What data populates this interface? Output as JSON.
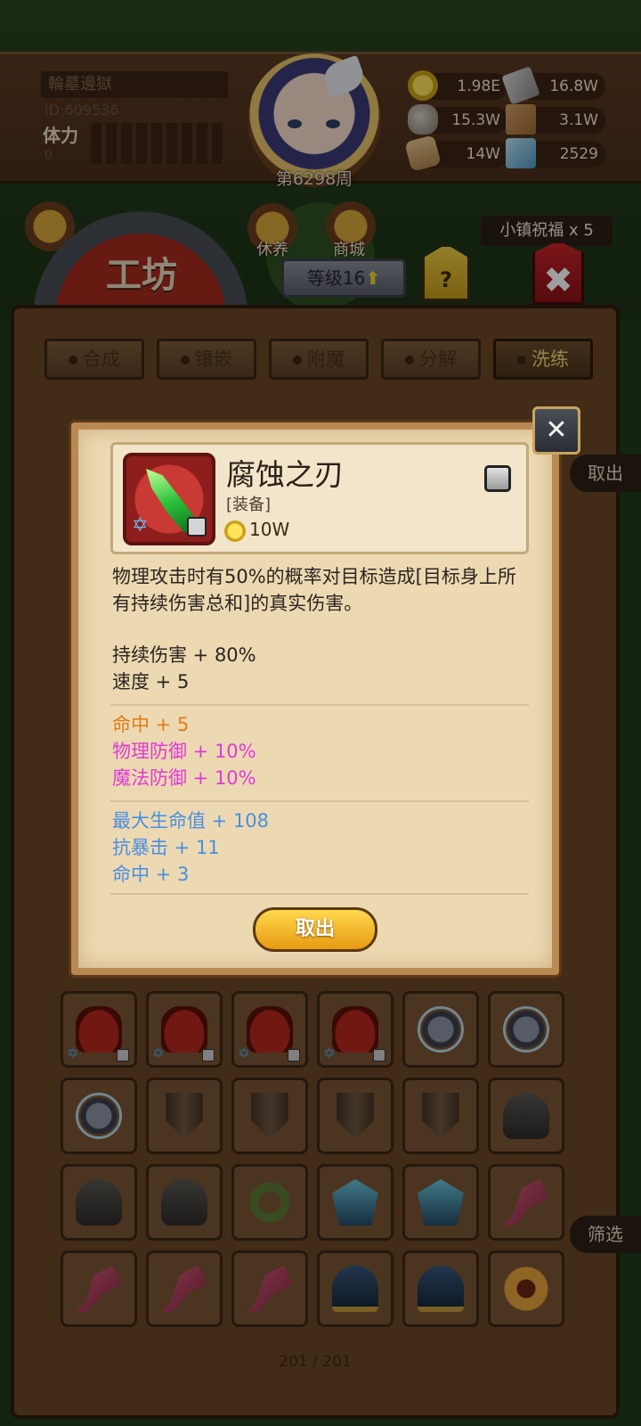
{
  "player": {
    "name": "輪墓邊獄",
    "id": "ID:609536",
    "stamina_label": "体力",
    "stamina_value": "0",
    "week": "第6298周"
  },
  "resources": {
    "gold": "1.98E",
    "ingot": "16.8W",
    "ore": "15.3W",
    "cloth": "3.1W",
    "wood": "14W",
    "gem": "2529"
  },
  "nav": {
    "rest": "休养",
    "shop": "商城",
    "blessing": "小镇祝福 x 5"
  },
  "workshop": {
    "title": "工坊",
    "level": "等级16",
    "help": "?",
    "close": "✖",
    "tabs": [
      {
        "label": "合成",
        "active": false
      },
      {
        "label": "镶嵌",
        "active": false
      },
      {
        "label": "附魔",
        "active": false
      },
      {
        "label": "分解",
        "active": false
      },
      {
        "label": "洗练",
        "active": true
      }
    ],
    "side_take": "取出",
    "side_filter": "筛选",
    "count": "201 / 201"
  },
  "inventory": [
    {
      "icon": "hat-icon",
      "star": true,
      "lock": true
    },
    {
      "icon": "hat-icon",
      "star": true,
      "lock": true
    },
    {
      "icon": "hat-icon",
      "star": true,
      "lock": true
    },
    {
      "icon": "hat-icon",
      "star": true,
      "lock": true
    },
    {
      "icon": "amulet-icon",
      "star": false,
      "lock": false
    },
    {
      "icon": "amulet-icon",
      "star": false,
      "lock": false
    },
    {
      "icon": "amulet-icon",
      "star": false,
      "lock": false
    },
    {
      "icon": "shield-icon",
      "star": false,
      "lock": false
    },
    {
      "icon": "shield-icon",
      "star": false,
      "lock": false
    },
    {
      "icon": "shield-icon",
      "star": false,
      "lock": false
    },
    {
      "icon": "shield-icon",
      "star": false,
      "lock": false
    },
    {
      "icon": "helm-icon",
      "star": false,
      "lock": false
    },
    {
      "icon": "helm-icon",
      "star": false,
      "lock": false
    },
    {
      "icon": "helm-icon",
      "star": false,
      "lock": false
    },
    {
      "icon": "ring-icon",
      "star": false,
      "lock": false
    },
    {
      "icon": "blue-helm-icon",
      "star": false,
      "lock": false
    },
    {
      "icon": "blue-helm-icon",
      "star": false,
      "lock": false
    },
    {
      "icon": "axe-icon",
      "star": false,
      "lock": false
    },
    {
      "icon": "axe-icon",
      "star": false,
      "lock": false
    },
    {
      "icon": "axe-icon",
      "star": false,
      "lock": false
    },
    {
      "icon": "axe-icon",
      "star": false,
      "lock": false
    },
    {
      "icon": "big-helm-icon",
      "star": false,
      "lock": false
    },
    {
      "icon": "big-helm-icon",
      "star": false,
      "lock": false
    },
    {
      "icon": "crown-icon",
      "star": false,
      "lock": false
    }
  ],
  "popup": {
    "close_icon": "close-icon",
    "item_name": "腐蚀之刃",
    "item_type": "[装备]",
    "price": "10W",
    "description": "物理攻击时有50%的概率对目标造成[目标身上所有持续伤害总和]的真实伤害。",
    "base_stats": [
      "持续伤害 + 80%",
      "速度 + 5"
    ],
    "orange_stats": [
      {
        "text": "命中 + 5",
        "color": "#e07b15"
      },
      {
        "text": "物理防御 + 10%",
        "color": "#e13ad6"
      },
      {
        "text": "魔法防御 + 10%",
        "color": "#e13ad6"
      }
    ],
    "blue_stats": [
      "最大生命值 + 108",
      "抗暴击 + 11",
      "命中 + 3"
    ],
    "take_button": "取出"
  }
}
